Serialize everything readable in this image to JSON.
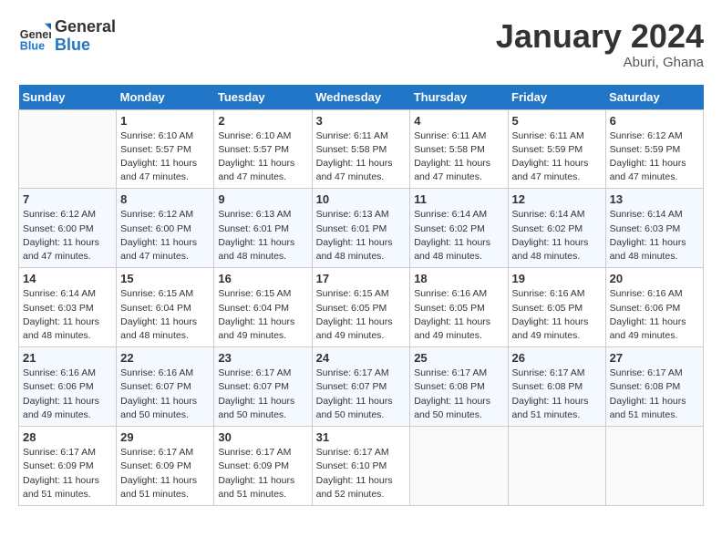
{
  "header": {
    "logo_line1": "General",
    "logo_line2": "Blue",
    "title": "January 2024",
    "subtitle": "Aburi, Ghana"
  },
  "columns": [
    "Sunday",
    "Monday",
    "Tuesday",
    "Wednesday",
    "Thursday",
    "Friday",
    "Saturday"
  ],
  "weeks": [
    [
      {
        "day": "",
        "empty": true
      },
      {
        "day": "1",
        "sunrise": "6:10 AM",
        "sunset": "5:57 PM",
        "daylight": "11 hours and 47 minutes."
      },
      {
        "day": "2",
        "sunrise": "6:10 AM",
        "sunset": "5:57 PM",
        "daylight": "11 hours and 47 minutes."
      },
      {
        "day": "3",
        "sunrise": "6:11 AM",
        "sunset": "5:58 PM",
        "daylight": "11 hours and 47 minutes."
      },
      {
        "day": "4",
        "sunrise": "6:11 AM",
        "sunset": "5:58 PM",
        "daylight": "11 hours and 47 minutes."
      },
      {
        "day": "5",
        "sunrise": "6:11 AM",
        "sunset": "5:59 PM",
        "daylight": "11 hours and 47 minutes."
      },
      {
        "day": "6",
        "sunrise": "6:12 AM",
        "sunset": "5:59 PM",
        "daylight": "11 hours and 47 minutes."
      }
    ],
    [
      {
        "day": "7",
        "sunrise": "6:12 AM",
        "sunset": "6:00 PM",
        "daylight": "11 hours and 47 minutes."
      },
      {
        "day": "8",
        "sunrise": "6:12 AM",
        "sunset": "6:00 PM",
        "daylight": "11 hours and 47 minutes."
      },
      {
        "day": "9",
        "sunrise": "6:13 AM",
        "sunset": "6:01 PM",
        "daylight": "11 hours and 48 minutes."
      },
      {
        "day": "10",
        "sunrise": "6:13 AM",
        "sunset": "6:01 PM",
        "daylight": "11 hours and 48 minutes."
      },
      {
        "day": "11",
        "sunrise": "6:14 AM",
        "sunset": "6:02 PM",
        "daylight": "11 hours and 48 minutes."
      },
      {
        "day": "12",
        "sunrise": "6:14 AM",
        "sunset": "6:02 PM",
        "daylight": "11 hours and 48 minutes."
      },
      {
        "day": "13",
        "sunrise": "6:14 AM",
        "sunset": "6:03 PM",
        "daylight": "11 hours and 48 minutes."
      }
    ],
    [
      {
        "day": "14",
        "sunrise": "6:14 AM",
        "sunset": "6:03 PM",
        "daylight": "11 hours and 48 minutes."
      },
      {
        "day": "15",
        "sunrise": "6:15 AM",
        "sunset": "6:04 PM",
        "daylight": "11 hours and 48 minutes."
      },
      {
        "day": "16",
        "sunrise": "6:15 AM",
        "sunset": "6:04 PM",
        "daylight": "11 hours and 49 minutes."
      },
      {
        "day": "17",
        "sunrise": "6:15 AM",
        "sunset": "6:05 PM",
        "daylight": "11 hours and 49 minutes."
      },
      {
        "day": "18",
        "sunrise": "6:16 AM",
        "sunset": "6:05 PM",
        "daylight": "11 hours and 49 minutes."
      },
      {
        "day": "19",
        "sunrise": "6:16 AM",
        "sunset": "6:05 PM",
        "daylight": "11 hours and 49 minutes."
      },
      {
        "day": "20",
        "sunrise": "6:16 AM",
        "sunset": "6:06 PM",
        "daylight": "11 hours and 49 minutes."
      }
    ],
    [
      {
        "day": "21",
        "sunrise": "6:16 AM",
        "sunset": "6:06 PM",
        "daylight": "11 hours and 49 minutes."
      },
      {
        "day": "22",
        "sunrise": "6:16 AM",
        "sunset": "6:07 PM",
        "daylight": "11 hours and 50 minutes."
      },
      {
        "day": "23",
        "sunrise": "6:17 AM",
        "sunset": "6:07 PM",
        "daylight": "11 hours and 50 minutes."
      },
      {
        "day": "24",
        "sunrise": "6:17 AM",
        "sunset": "6:07 PM",
        "daylight": "11 hours and 50 minutes."
      },
      {
        "day": "25",
        "sunrise": "6:17 AM",
        "sunset": "6:08 PM",
        "daylight": "11 hours and 50 minutes."
      },
      {
        "day": "26",
        "sunrise": "6:17 AM",
        "sunset": "6:08 PM",
        "daylight": "11 hours and 51 minutes."
      },
      {
        "day": "27",
        "sunrise": "6:17 AM",
        "sunset": "6:08 PM",
        "daylight": "11 hours and 51 minutes."
      }
    ],
    [
      {
        "day": "28",
        "sunrise": "6:17 AM",
        "sunset": "6:09 PM",
        "daylight": "11 hours and 51 minutes."
      },
      {
        "day": "29",
        "sunrise": "6:17 AM",
        "sunset": "6:09 PM",
        "daylight": "11 hours and 51 minutes."
      },
      {
        "day": "30",
        "sunrise": "6:17 AM",
        "sunset": "6:09 PM",
        "daylight": "11 hours and 51 minutes."
      },
      {
        "day": "31",
        "sunrise": "6:17 AM",
        "sunset": "6:10 PM",
        "daylight": "11 hours and 52 minutes."
      },
      {
        "day": "",
        "empty": true
      },
      {
        "day": "",
        "empty": true
      },
      {
        "day": "",
        "empty": true
      }
    ]
  ]
}
